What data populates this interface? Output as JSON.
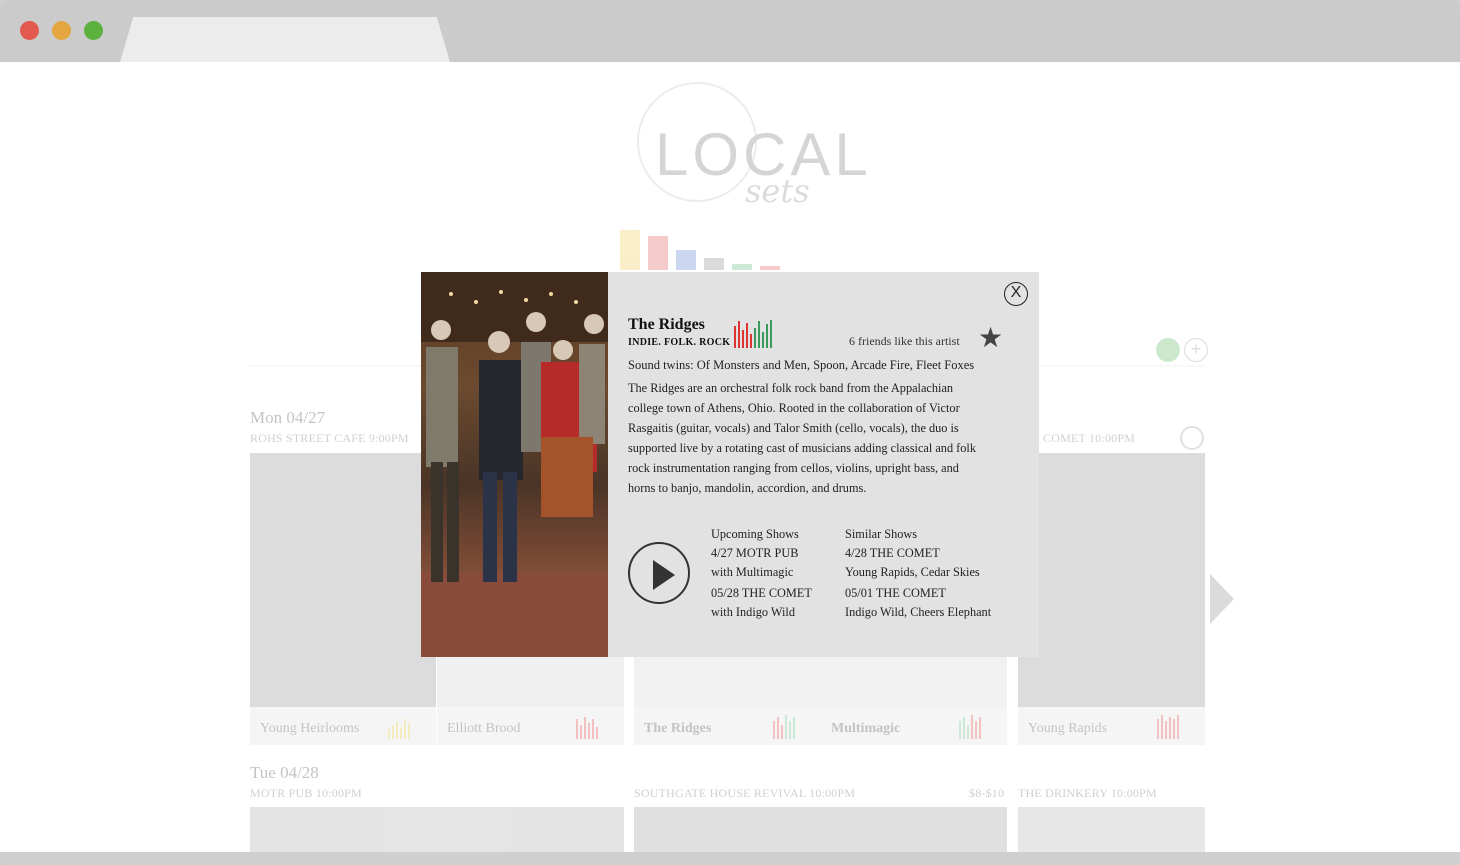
{
  "background": {
    "logo": {
      "word": "LOCAL",
      "script": "sets"
    },
    "days": [
      {
        "title": "Mon 04/27",
        "venues": [
          "ROHS STREET CAFE 9:00PM",
          "COMET 10:00PM"
        ]
      },
      {
        "title": "Tue 04/28",
        "venues": [
          "MOTR PUB 10:00PM",
          "SOUTHGATE HOUSE REVIVAL 10:00PM",
          "$8-$10",
          "THE DRINKERY 10:00PM"
        ]
      }
    ],
    "cards": [
      "Young Heirlooms",
      "Elliott Brood",
      "The Ridges",
      "Multimagic",
      "Young Rapids"
    ]
  },
  "modal": {
    "close_label": "X",
    "artist": "The Ridges",
    "genre": "INDIE. FOLK. ROCK",
    "friends": "6 friends like this artist",
    "star": "★",
    "sound_twins": "Sound twins: Of Monsters and Men, Spoon, Arcade Fire, Fleet Foxes",
    "bio": [
      "The Ridges are an orchestral folk rock band from the Appalachian",
      "college town of Athens, Ohio. Rooted in the collaboration of Victor",
      "Rasgaitis (guitar, vocals) and Talor Smith (cello, vocals), the duo is",
      "supported live by a rotating cast of musicians adding classical and folk",
      "rock instrumentation ranging from cellos, violins, upright bass, and",
      "horns to banjo, mandolin, accordion, and drums."
    ],
    "upcoming": {
      "heading": "Upcoming Shows",
      "items": [
        "4/27 MOTR PUB",
        "with Multimagic",
        "05/28 THE COMET",
        "with Indigo Wild"
      ]
    },
    "similar": {
      "heading": "Similar Shows",
      "items": [
        "4/28 THE COMET",
        "Young Rapids, Cedar Skies",
        "05/01 THE COMET",
        "Indigo Wild, Cheers Elephant"
      ]
    }
  }
}
